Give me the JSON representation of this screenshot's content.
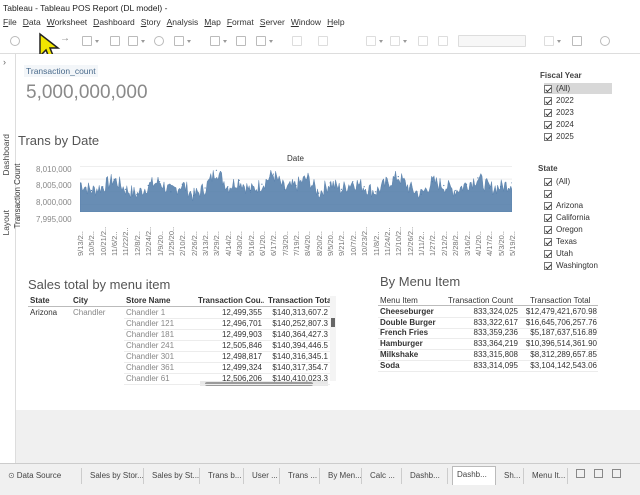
{
  "window": {
    "title": "Tableau - Tableau POS Report (DL model) -"
  },
  "menu": [
    "File",
    "Data",
    "Worksheet",
    "Dashboard",
    "Story",
    "Analysis",
    "Map",
    "Format",
    "Server",
    "Window",
    "Help"
  ],
  "side_tabs": {
    "dashboard": "Dashboard",
    "layout": "Layout"
  },
  "kpi": {
    "label": "Transaction_count",
    "value": "5,000,000,000"
  },
  "trend": {
    "title": "Trans by Date",
    "header": "Date",
    "ylabel": "Transaction Count",
    "yticks": [
      "8,010,000",
      "8,005,000",
      "8,000,000",
      "7,995,000"
    ],
    "xticks": [
      "9/13/2..",
      "10/5/2..",
      "10/21/2..",
      "11/6/2..",
      "11/22/2..",
      "12/8/2..",
      "12/24/2..",
      "1/9/20..",
      "1/25/20..",
      "2/10/2..",
      "2/26/2..",
      "3/13/2..",
      "3/29/2..",
      "4/14/2..",
      "4/30/2..",
      "5/16/2..",
      "6/1/20..",
      "6/17/2..",
      "7/3/20..",
      "7/19/2..",
      "8/4/20..",
      "8/20/2..",
      "9/5/20..",
      "9/21/2..",
      "10/7/2..",
      "10/23/2..",
      "11/8/2..",
      "11/24/2..",
      "12/10/2..",
      "12/26/2..",
      "1/11/2..",
      "1/27/2..",
      "2/12/2..",
      "2/28/2..",
      "3/16/2..",
      "4/1/20..",
      "4/17/2..",
      "5/3/20..",
      "5/19/2.."
    ],
    "color": "#4e79a7"
  },
  "chart_data": {
    "type": "area",
    "title": "Trans by Date",
    "xlabel": "Date",
    "ylabel": "Transaction Count",
    "ylim": [
      7992000,
      8011000
    ],
    "x": [
      "9/13",
      "10/5",
      "10/21",
      "11/6",
      "11/22",
      "12/8",
      "12/24",
      "1/9",
      "1/25",
      "2/10",
      "2/26",
      "3/13",
      "3/29",
      "4/14",
      "4/30",
      "5/16",
      "6/1",
      "6/17",
      "7/3",
      "7/19",
      "8/4",
      "8/20",
      "9/5",
      "9/21",
      "10/7",
      "10/23",
      "11/8",
      "11/24",
      "12/10",
      "12/26",
      "1/11",
      "1/27",
      "2/12",
      "2/28",
      "3/16",
      "4/1",
      "4/17",
      "5/3",
      "5/19"
    ],
    "values": [
      8003500,
      8000500,
      8002000,
      8005000,
      8001000,
      7999000,
      8002500,
      8004000,
      8000000,
      8003000,
      7998500,
      8001500,
      8008500,
      8002000,
      8004500,
      8000500,
      8003000,
      8007000,
      8001000,
      8002500,
      8005500,
      7999500,
      8003500,
      8001000,
      8004000,
      8002000,
      8000000,
      8003500,
      8006000,
      8001500,
      7999000,
      8004000,
      8002500,
      8000500,
      8003000,
      8005500,
      8001500,
      8002000,
      8003500
    ]
  },
  "filters": {
    "fiscal_year": {
      "title": "Fiscal Year",
      "items": [
        "(All)",
        "2022",
        "2023",
        "2024",
        "2025"
      ]
    },
    "state": {
      "title": "State",
      "items": [
        "(All)",
        "",
        "Arizona",
        "California",
        "Oregon",
        "Texas",
        "Utah",
        "Washington"
      ]
    }
  },
  "sales": {
    "title": "Sales total by menu item",
    "headers": [
      "State",
      "City",
      "Store Name",
      "Transaction Cou..",
      "Transaction Total"
    ],
    "state": "Arizona",
    "city": "Chandler",
    "rows": [
      [
        "Chandler 1",
        "12,499,355",
        "$140,313,607.2"
      ],
      [
        "Chandler 121",
        "12,496,701",
        "$140,252,807.3"
      ],
      [
        "Chandler 181",
        "12,499,903",
        "$140,364,427.3"
      ],
      [
        "Chandler 241",
        "12,505,846",
        "$140,394,446.5"
      ],
      [
        "Chandler 301",
        "12,498,817",
        "$140,316,345.1"
      ],
      [
        "Chandler 361",
        "12,499,324",
        "$140,317,354.7"
      ],
      [
        "Chandler 61",
        "12,506,206",
        "$140,410,023.3"
      ]
    ]
  },
  "menu_items": {
    "title": "By Menu Item",
    "headers": [
      "Menu Item",
      "Transaction Count",
      "Transaction Total"
    ],
    "rows": [
      [
        "Cheeseburger",
        "833,324,025",
        "$12,479,421,670.98"
      ],
      [
        "Double Burger",
        "833,322,617",
        "$16,645,706,257.76"
      ],
      [
        "French Fries",
        "833,359,236",
        "$5,187,637,516.89"
      ],
      [
        "Hamburger",
        "833,364,219",
        "$10,396,514,361.90"
      ],
      [
        "Milkshake",
        "833,315,808",
        "$8,312,289,657.85"
      ],
      [
        "Soda",
        "833,314,095",
        "$3,104,142,543.06"
      ]
    ]
  },
  "sheet_tabs": [
    "Data Source",
    "Sales by Stor...",
    "Sales by St...",
    "Trans b...",
    "User ...",
    "Trans ...",
    "By Men...",
    "Calc ...",
    "Dashb...",
    "Dashb...",
    "Sh...",
    "Menu It..."
  ],
  "active_tab_index": 9
}
